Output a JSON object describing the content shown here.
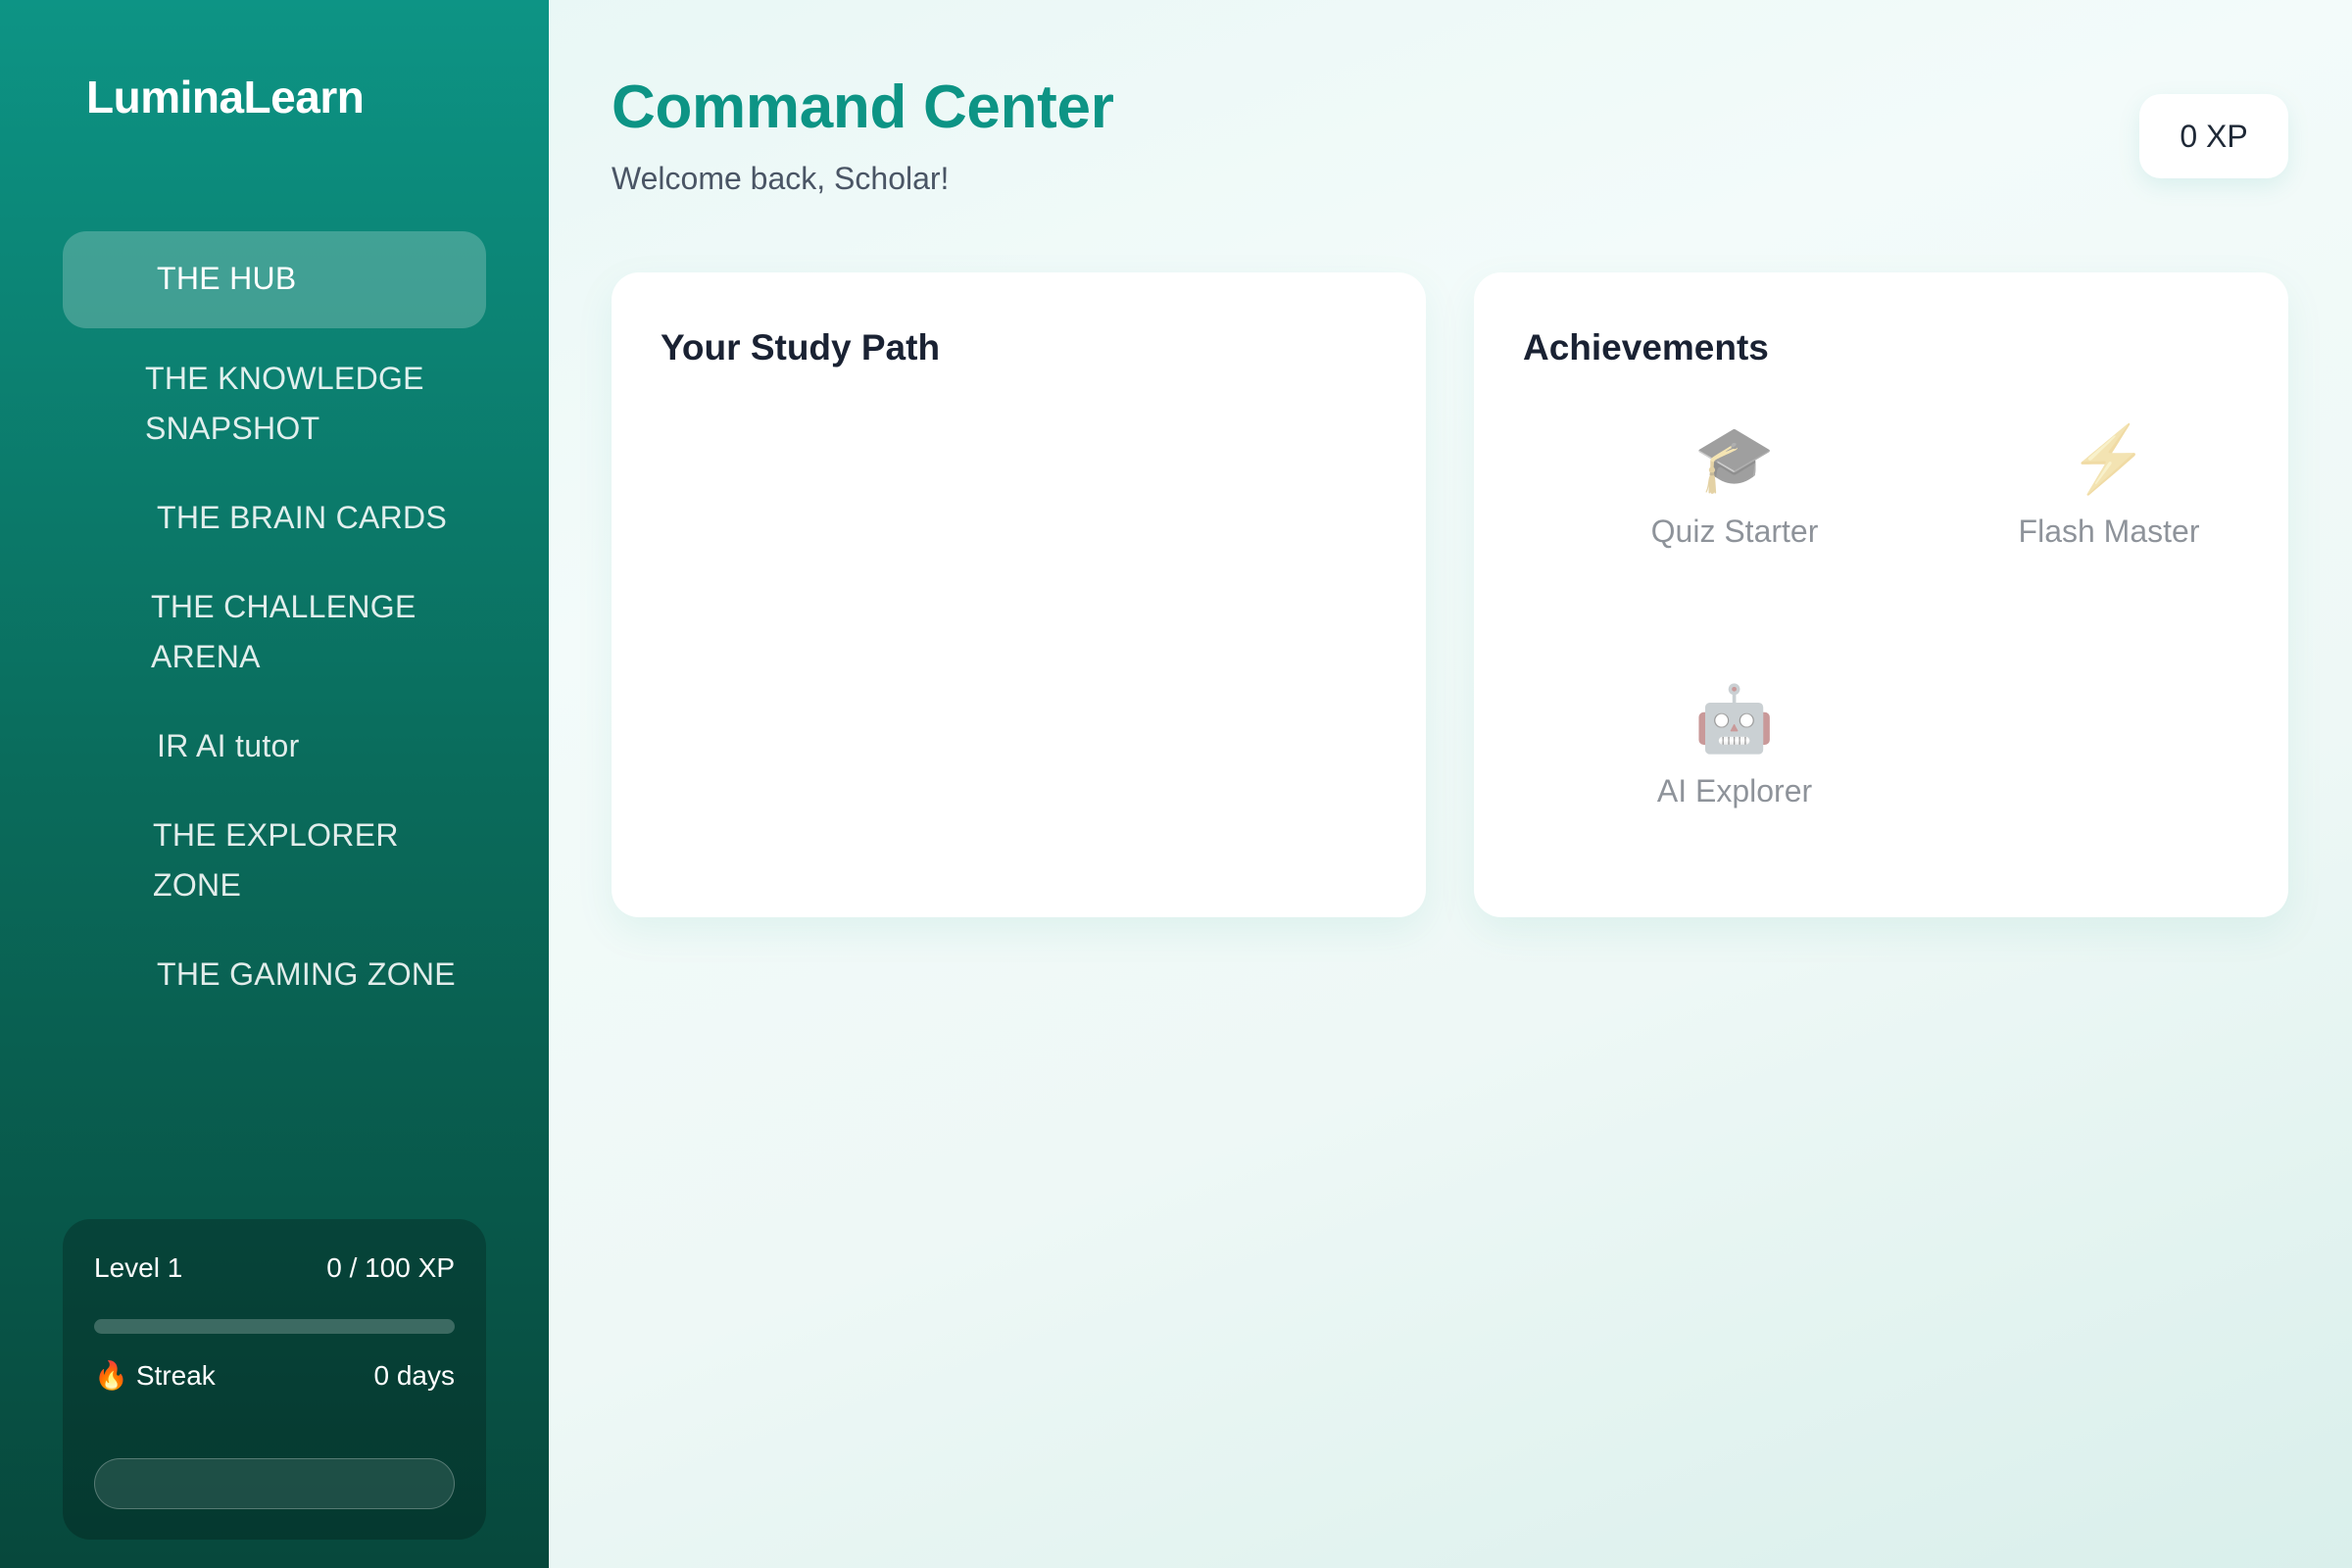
{
  "app": {
    "brand": "LuminaLearn"
  },
  "sidebar": {
    "items": [
      {
        "label": "THE HUB",
        "active": true
      },
      {
        "label": "THE KNOWLEDGE SNAPSHOT"
      },
      {
        "label": "THE BRAIN CARDS"
      },
      {
        "label": "THE CHALLENGE ARENA"
      },
      {
        "label": "IR AI tutor"
      },
      {
        "label": "THE EXPLORER ZONE"
      },
      {
        "label": "THE GAMING ZONE"
      }
    ],
    "stats": {
      "level_label": "Level 1",
      "xp_progress": "0 / 100 XP",
      "xp_fraction": 0,
      "streak_icon": "flame-icon",
      "streak_label": "Streak",
      "streak_value": "0 days"
    }
  },
  "header": {
    "title": "Command Center",
    "subtitle": "Welcome back, Scholar!",
    "xp_badge": "0 XP"
  },
  "cards": {
    "study_path": {
      "title": "Your Study Path"
    },
    "achievements": {
      "title": "Achievements",
      "items": [
        {
          "icon": "graduation-cap-icon",
          "glyph": "🎓",
          "label": "Quiz Starter"
        },
        {
          "icon": "lightning-icon",
          "glyph": "⚡",
          "label": "Flash Master"
        },
        {
          "icon": "robot-icon",
          "glyph": "🤖",
          "label": "AI Explorer"
        }
      ]
    }
  },
  "colors": {
    "accent": "#0d9485",
    "sidebar_top": "#0d9485",
    "sidebar_bottom": "#07483c",
    "heading": "#1a2233"
  }
}
